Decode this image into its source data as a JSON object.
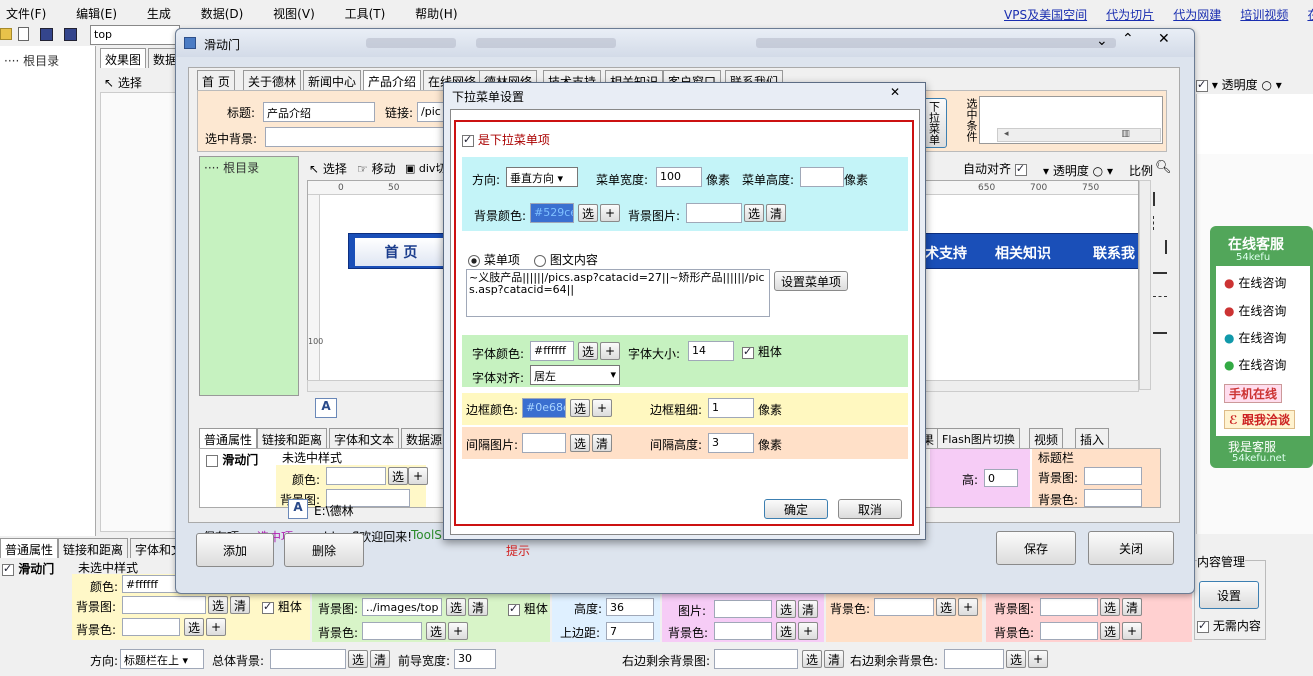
{
  "menubar": [
    "文件(F)",
    "编辑(E)",
    "生成",
    "数据(D)",
    "视图(V)",
    "工具(T)",
    "帮助(H)"
  ],
  "top_links": [
    "VPS及美国空间",
    "代为切片",
    "代为网建",
    "培训视频",
    "在线"
  ],
  "path_input": "top",
  "tree_root": "根目录",
  "bg_tabs": [
    "效果图",
    "数据"
  ],
  "bg_toolbar": {
    "select": "选择",
    "opacity": "透明度",
    "ratio": "比例"
  },
  "right_chat": {
    "header": "在线客服",
    "sub": "54kefu",
    "items": [
      "在线咨询",
      "在线咨询",
      "在线咨询",
      "在线咨询"
    ],
    "phone": "手机在线",
    "talk": "跟我洽谈",
    "footer": "我是客服",
    "footer_sub": "54kefu.net"
  },
  "bottom_tabs": [
    "普通属性",
    "链接和距离",
    "字体和文"
  ],
  "bottom": {
    "title": "滑动门",
    "unselected": "未选中样式",
    "color_label": "颜色:",
    "color_val": "#ffffff",
    "bgimg_label": "背景图:",
    "bgcolor_label": "背景色:",
    "bold": "粗体",
    "bgimg2_val": "../images/top",
    "height_label": "高度:",
    "height_val": "36",
    "top_label": "上边距:",
    "top_val": "7",
    "img_label": "图片:",
    "dir_label": "方向:",
    "dir_val": "标题栏在上",
    "total_bg": "总体背景:",
    "lead_width": "前导宽度:",
    "lead_val": "30",
    "right_bg": "右边剩余背景图:",
    "right_bgc": "右边剩余背景色:",
    "content_mgmt": "内容管理",
    "setting": "设置",
    "no_content": "无需内容"
  },
  "main_dialog": {
    "title": "滑动门",
    "tabs": [
      "首 页",
      "关于德林",
      "新闻中心",
      "产品介绍",
      "在线网络",
      "德林网络",
      "技术支持",
      "相关知识",
      "客户窗口",
      "联系我们"
    ],
    "title_label": "标题:",
    "title_val": "产品介绍",
    "link_label": "链接:",
    "link_val": "/pic",
    "sel_bg_label": "选中背景:",
    "side_btn": "下拉菜单",
    "sel_cond": "选中条件",
    "tree_root": "根目录",
    "toolbar": {
      "select": "选择",
      "move": "移动",
      "div": "div切",
      "align": "自动对齐",
      "opacity": "透明度",
      "ratio": "比例"
    },
    "ruler_top": [
      "0",
      "50",
      "650",
      "700",
      "750"
    ],
    "ruler_left": [
      "50",
      "100",
      "150",
      "100"
    ],
    "nav_items": [
      "首 页",
      "术支持",
      "相关知识",
      "联系我"
    ],
    "prop_tabs": [
      "普通属性",
      "链接和距离",
      "字体和文本",
      "数据源",
      "果",
      "Flash图片切换",
      "视频",
      "插入"
    ],
    "props": {
      "title": "滑动门",
      "unselected": "未选中样式",
      "color": "颜色:",
      "bgimg": "背景图:",
      "titlebar": "标题栏",
      "bgimg2": "背景图:",
      "bgcolor2": "背景色:",
      "height": "高:",
      "height_val": "0"
    },
    "status": {
      "label": "保存项:",
      "sel": "选中项:",
      "msg": "cddxwfl欢迎回来!",
      "tool": "ToolS"
    },
    "path": "E:\\德林",
    "add": "添加",
    "del": "删除",
    "save": "保存",
    "close": "关闭"
  },
  "dropdown_dialog": {
    "title": "下拉菜单设置",
    "is_dropdown": "是下拉菜单项",
    "dir_label": "方向:",
    "dir_val": "垂直方向",
    "menu_w_label": "菜单宽度:",
    "menu_w_val": "100",
    "unit": "像素",
    "menu_h_label": "菜单高度:",
    "bgcolor_label": "背景颜色:",
    "bgcolor_val": "#529ce2",
    "bgimg_label": "背景图片:",
    "pick": "选",
    "clear": "清",
    "plus": "+",
    "radio_menu": "菜单项",
    "radio_rich": "图文内容",
    "menu_text": "~义肢产品||||||/pics.asp?catacid=27||~矫形产品||||||/pics.asp?catacid=64||",
    "set_menu": "设置菜单项",
    "font_color_label": "字体颜色:",
    "font_color_val": "#ffffff",
    "font_size_label": "字体大小:",
    "font_size_val": "14",
    "bold": "粗体",
    "align_label": "字体对齐:",
    "align_val": "居左",
    "border_color_label": "边框颜色:",
    "border_color_val": "#0e68e6",
    "border_w_label": "边框粗细:",
    "border_w_val": "1",
    "gap_img_label": "间隔图片:",
    "gap_h_label": "间隔高度:",
    "gap_h_val": "3",
    "ok": "确定",
    "cancel": "取消",
    "hint": "提示"
  },
  "colors": {
    "nav_blue": "#1a4fb8",
    "panel_cyan": "#c4f4f8",
    "panel_green": "#c6f2c0",
    "panel_yellow": "#fff8c0",
    "panel_peach": "#ffe0c8",
    "dropdown_border": "#cc1111"
  }
}
